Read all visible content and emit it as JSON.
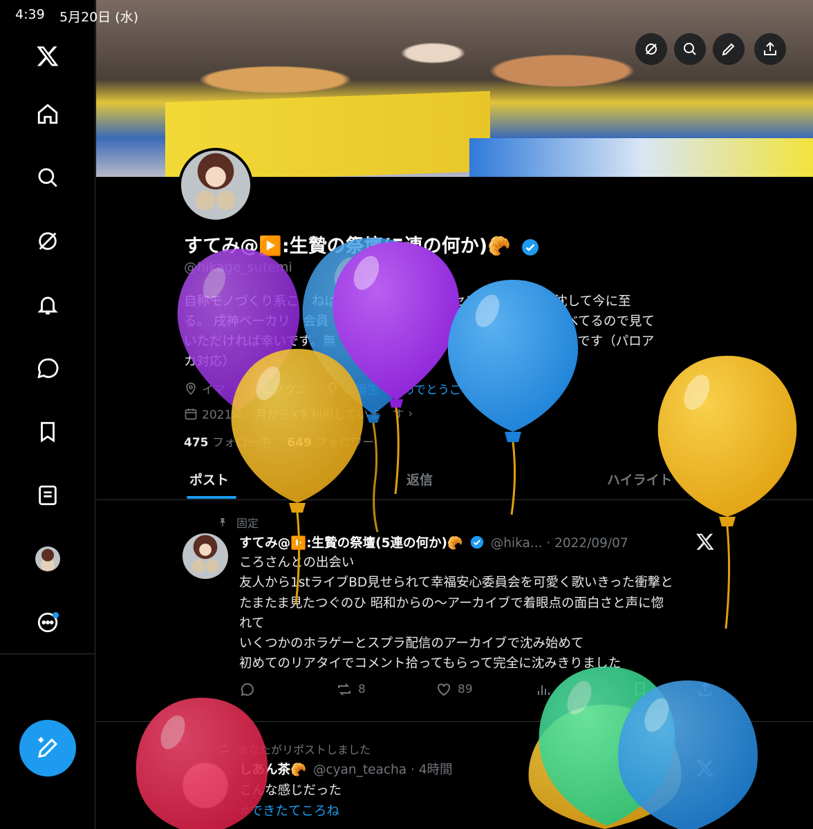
{
  "status_bar": {
    "time": "4:39",
    "date": "5月20日 (水)"
  },
  "sidebar": {
    "items": [
      {
        "icon": "x-logo-icon"
      },
      {
        "icon": "home-icon"
      },
      {
        "icon": "search-icon"
      },
      {
        "icon": "grok-icon"
      },
      {
        "icon": "notifications-bell-icon"
      },
      {
        "icon": "messages-icon"
      },
      {
        "icon": "bookmarks-icon"
      },
      {
        "icon": "lists-icon"
      },
      {
        "icon": "profile-avatar"
      },
      {
        "icon": "more-icon"
      }
    ],
    "compose_icon": "compose-post-icon"
  },
  "banner": {
    "buttons": [
      "grok-icon",
      "search-icon",
      "edit-icon",
      "share-icon"
    ]
  },
  "profile": {
    "display_name": "すてみ@▶️:生贄の祭壇(5連の何か)🥐",
    "handle": "@hikage_sutemi",
    "bio_lines": [
      "自称モノづくり系こ　ねば　　　ろさんの歌とセンスと訛りに撃沈して今に至",
      "る。 戌神ベーカリ　会員　5003　ハイライトにものづくり作品並べてるので見て",
      "いただければ幸いです。無　　ア　　　す。戌神ころねさんのファンです（パロア",
      "カ対応）"
    ],
    "location": "イマ　　　ヒノクニ",
    "birthday": "お誕生　おめでとうございます。",
    "joined": "2021年　月からXを利用していま　す",
    "following_count": "475",
    "following_label": "フォロー中",
    "followers_count": "649",
    "followers_label": "フォロワー"
  },
  "tabs": [
    "ポスト",
    "返信",
    "ハイライト"
  ],
  "pinned_post": {
    "label": "固定",
    "name": "すてみ@▶️:生贄の祭壇(5連の何か)🥐",
    "handle_time": "@hika... · 2022/09/07",
    "body_lines": [
      "ころさんとの出会い",
      "友人から1stライブBD見せられて幸福安心委員会を可愛く歌いきった衝撃と",
      "たまたま見たつぐのひ 昭和からの〜アーカイブで着眼点の面白さと声に惚",
      "れて",
      "いくつかのホラゲーとスプラ配信のアーカイブで沈み始めて",
      "初めてのリアタイでコメント拾ってもらって完全に沈みきりました"
    ],
    "reply_count": "",
    "repost_count": "8",
    "like_count": "89"
  },
  "repost": {
    "label": "あなたがリポストしました",
    "name": "しあん茶🥐",
    "handle_time": "@cyan_teacha · 4時間",
    "body": "こんな感じだった",
    "hashtag": "#できたてころね"
  },
  "colors": {
    "accent": "#1d9bf0",
    "background": "#000000",
    "balloon_purple": "#9b30e0",
    "balloon_blue": "#2a8fe0",
    "balloon_yellow": "#f0b41c",
    "balloon_red": "#e0264e",
    "balloon_green": "#2ed08a"
  }
}
